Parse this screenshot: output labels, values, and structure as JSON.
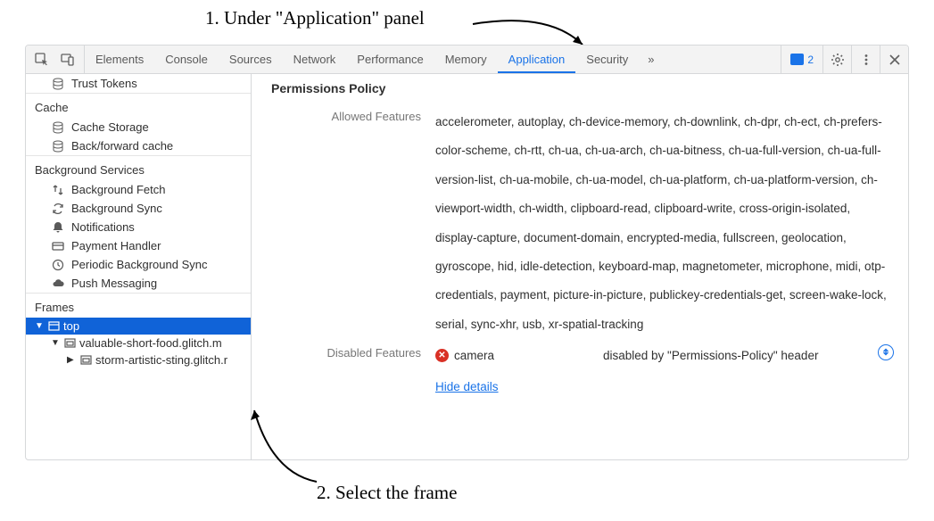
{
  "annotations": {
    "step1": "1. Under \"Application\" panel",
    "step2": "2. Select the frame"
  },
  "tabs": {
    "elements": "Elements",
    "console": "Console",
    "sources": "Sources",
    "network": "Network",
    "performance": "Performance",
    "memory": "Memory",
    "application": "Application",
    "security": "Security",
    "overflow": "»",
    "message_count": "2"
  },
  "sidebar": {
    "trust_tokens": "Trust Tokens",
    "cache_title": "Cache",
    "cache_storage": "Cache Storage",
    "bf_cache": "Back/forward cache",
    "bg_title": "Background Services",
    "bg_fetch": "Background Fetch",
    "bg_sync": "Background Sync",
    "notifications": "Notifications",
    "payment": "Payment Handler",
    "periodic": "Periodic Background Sync",
    "push": "Push Messaging",
    "frames_title": "Frames",
    "frame_top": "top",
    "frame_child1": "valuable-short-food.glitch.m",
    "frame_child2": "storm-artistic-sting.glitch.r"
  },
  "main": {
    "title": "Permissions Policy",
    "allowed_label": "Allowed Features",
    "allowed_value": "accelerometer, autoplay, ch-device-memory, ch-downlink, ch-dpr, ch-ect, ch-prefers-color-scheme, ch-rtt, ch-ua, ch-ua-arch, ch-ua-bitness, ch-ua-full-version, ch-ua-full-version-list, ch-ua-mobile, ch-ua-model, ch-ua-platform, ch-ua-platform-version, ch-viewport-width, ch-width, clipboard-read, clipboard-write, cross-origin-isolated, display-capture, document-domain, encrypted-media, fullscreen, geolocation, gyroscope, hid, idle-detection, keyboard-map, magnetometer, microphone, midi, otp-credentials, payment, picture-in-picture, publickey-credentials-get, screen-wake-lock, serial, sync-xhr, usb, xr-spatial-tracking",
    "disabled_label": "Disabled Features",
    "disabled_item": "camera",
    "disabled_reason": "disabled by \"Permissions-Policy\" header",
    "hide_details": "Hide details"
  }
}
